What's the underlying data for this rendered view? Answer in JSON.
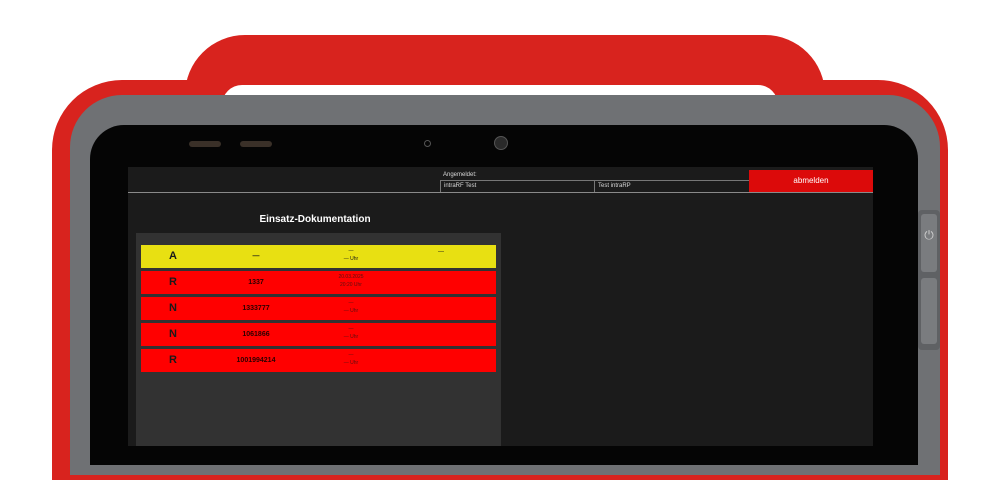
{
  "header": {
    "logged_in_label": "Angemeldet:",
    "login_cell_1": "intraRF Test",
    "login_cell_2": "Test intraRP",
    "logout_label": "abmelden"
  },
  "main": {
    "title": "Einsatz-Dokumentation"
  },
  "records": [
    {
      "letter": "A",
      "number": "—",
      "time_line1": "—",
      "time_line2": "— Uhr",
      "extra": "—",
      "status_color": "#e8e012"
    },
    {
      "letter": "R",
      "number": "1337",
      "time_line1": "20.03.2025",
      "time_line2": "20:20 Uhr",
      "extra": "",
      "status_color": "#ff0000"
    },
    {
      "letter": "N",
      "number": "1333777",
      "time_line1": "—",
      "time_line2": "— Uhr",
      "extra": "",
      "status_color": "#ff0000"
    },
    {
      "letter": "N",
      "number": "1061866",
      "time_line1": "—",
      "time_line2": "— Uhr",
      "extra": "",
      "status_color": "#ff0000"
    },
    {
      "letter": "R",
      "number": "1001994214",
      "time_line1": "—",
      "time_line2": "— Uhr",
      "extra": "",
      "status_color": "#ff0000"
    }
  ],
  "device": {
    "shell_color": "#d8231e",
    "bumper_color": "#6f7174",
    "power_icon": "power-icon"
  }
}
